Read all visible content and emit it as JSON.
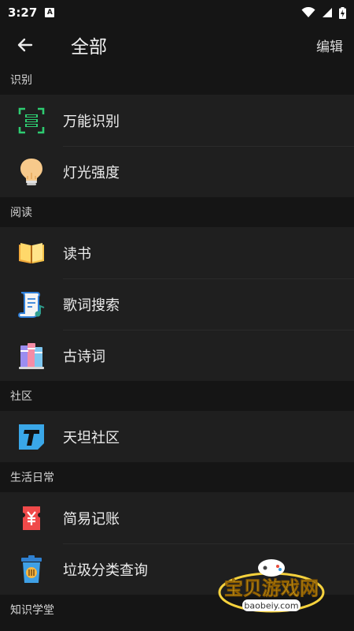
{
  "status": {
    "time": "3:27"
  },
  "header": {
    "title": "全部",
    "edit_label": "编辑"
  },
  "sections": [
    {
      "title": "识别",
      "items": [
        {
          "label": "万能识别",
          "icon": "scan-text-icon"
        },
        {
          "label": "灯光强度",
          "icon": "light-bulb-icon"
        }
      ]
    },
    {
      "title": "阅读",
      "items": [
        {
          "label": "读书",
          "icon": "open-book-icon"
        },
        {
          "label": "歌词搜索",
          "icon": "lyrics-scroll-icon"
        },
        {
          "label": "古诗词",
          "icon": "books-stack-icon"
        }
      ]
    },
    {
      "title": "社区",
      "items": [
        {
          "label": "天坦社区",
          "icon": "t-logo-icon"
        }
      ]
    },
    {
      "title": "生活日常",
      "items": [
        {
          "label": "简易记账",
          "icon": "yuan-ticket-icon"
        },
        {
          "label": "垃圾分类查询",
          "icon": "trash-bin-icon"
        }
      ]
    },
    {
      "title": "知识学堂",
      "items": []
    }
  ],
  "watermark": {
    "text": "宝贝游戏网",
    "url": "baobeiy.com"
  }
}
